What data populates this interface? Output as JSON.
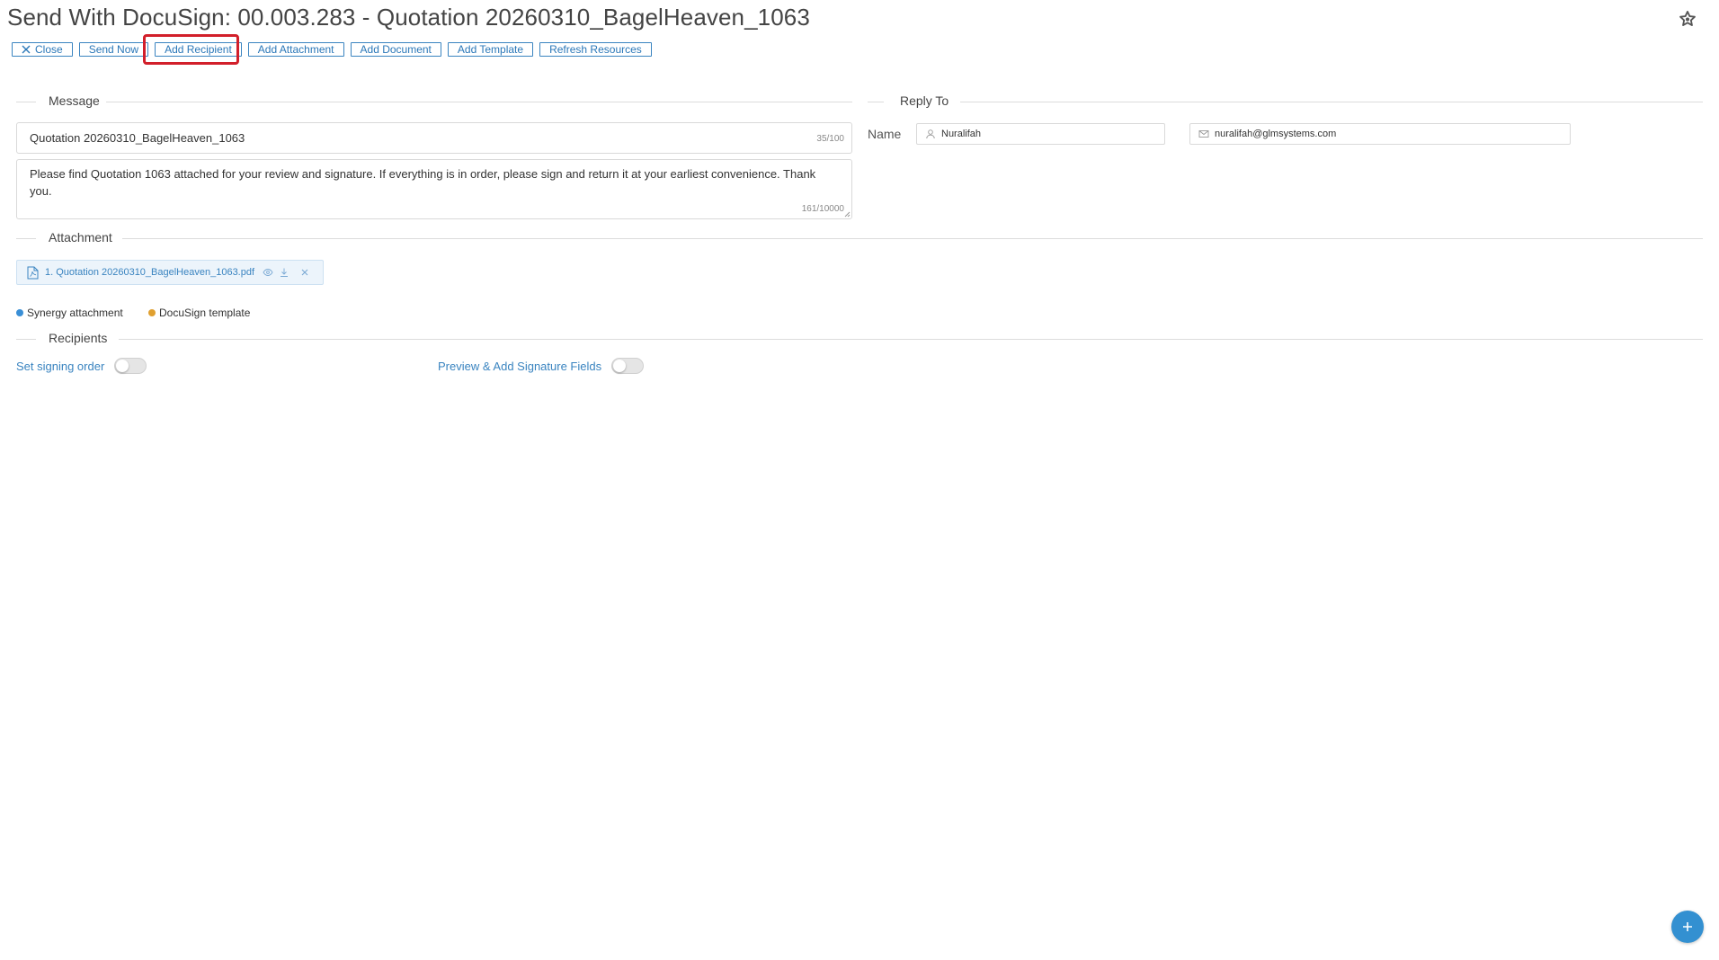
{
  "page": {
    "title": "Send With DocuSign: 00.003.283 - Quotation 20260310_BagelHeaven_1063"
  },
  "toolbar": {
    "close": "Close",
    "send_now": "Send Now",
    "add_recipient": "Add Recipient",
    "add_attachment": "Add Attachment",
    "add_document": "Add Document",
    "add_template": "Add Template",
    "refresh_resources": "Refresh Resources"
  },
  "message": {
    "section_label": "Message",
    "subject": "Quotation 20260310_BagelHeaven_1063",
    "subject_counter": "35/100",
    "body": "Please find Quotation 1063 attached for your review and signature. If everything is in order, please sign and return it at your earliest convenience. Thank you.",
    "body_counter": "161/10000"
  },
  "reply_to": {
    "section_label": "Reply To",
    "name_label": "Name",
    "name_value": "Nuralifah",
    "email_value": "nuralifah@glmsystems.com"
  },
  "attachment": {
    "section_label": "Attachment",
    "files": [
      {
        "label": "1. Quotation 20260310_BagelHeaven_1063.pdf"
      }
    ]
  },
  "legend": {
    "synergy": "Synergy attachment",
    "docusign": "DocuSign template",
    "synergy_color": "#3a8fd6",
    "docusign_color": "#e0a030"
  },
  "recipients": {
    "section_label": "Recipients",
    "signing_order_label": "Set signing order",
    "signing_order_on": false,
    "preview_label": "Preview & Add Signature Fields",
    "preview_on": false
  },
  "icons": {
    "star": "star-icon",
    "close": "close-icon",
    "user": "user-icon",
    "mail": "mail-icon",
    "pdf": "pdf-file-icon",
    "preview": "eye-icon",
    "download": "download-icon",
    "remove": "close-icon",
    "add": "plus-icon"
  },
  "colors": {
    "accent": "#3a84c0",
    "highlight": "#d21f2a"
  }
}
